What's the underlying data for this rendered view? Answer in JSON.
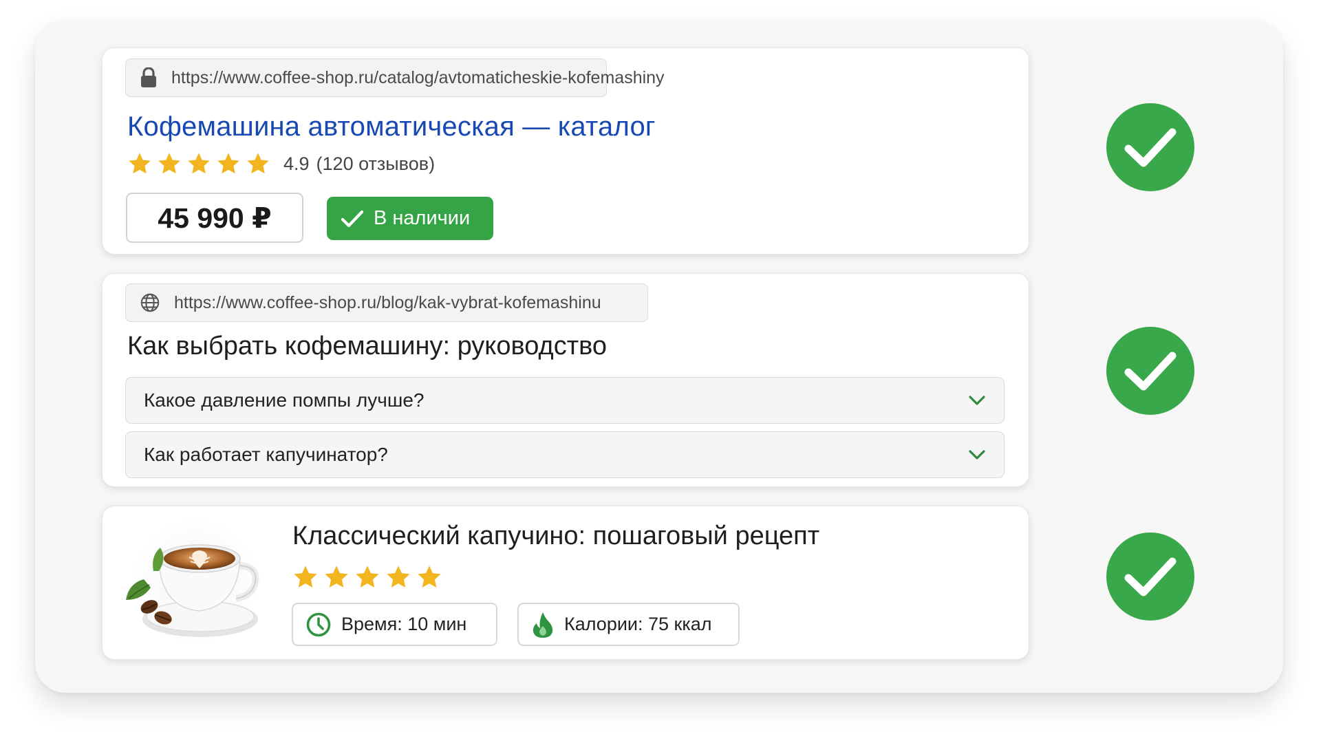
{
  "results": [
    {
      "url": "https://www.coffee-shop.ru/catalog/avtomaticheskie-kofemashiny",
      "url_icon": "lock-icon",
      "title": "Кофемашина автоматическая — каталог",
      "rating_stars": 5,
      "rating_value": "4.9",
      "reviews_text": "(120 отзывов)",
      "price": "45 990 ₽",
      "stock_label": "В наличии"
    },
    {
      "url": "https://www.coffee-shop.ru/blog/kak-vybrat-kofemashinu",
      "url_icon": "globe-icon",
      "title": "Как выбрать кофемашину: руководство",
      "faq": [
        {
          "question": "Какое давление помпы лучше?"
        },
        {
          "question": "Как работает капучинатор?"
        }
      ]
    },
    {
      "image": "cappuccino-cup-image",
      "title": "Классический капучино: пошаговый рецепт",
      "rating_stars": 5,
      "time_label": "Время: 10 мин",
      "time_icon": "clock-icon",
      "calories_label": "Калории: 75 ккал",
      "calories_icon": "flame-icon"
    }
  ],
  "status_icons": [
    "check-circle-icon",
    "check-circle-icon",
    "check-circle-icon"
  ],
  "colors": {
    "title_link": "#1848b4",
    "accent_green": "#35a447",
    "check_green": "#39a84a",
    "star": "#f3b51f",
    "chevron": "#2e8b3e"
  }
}
